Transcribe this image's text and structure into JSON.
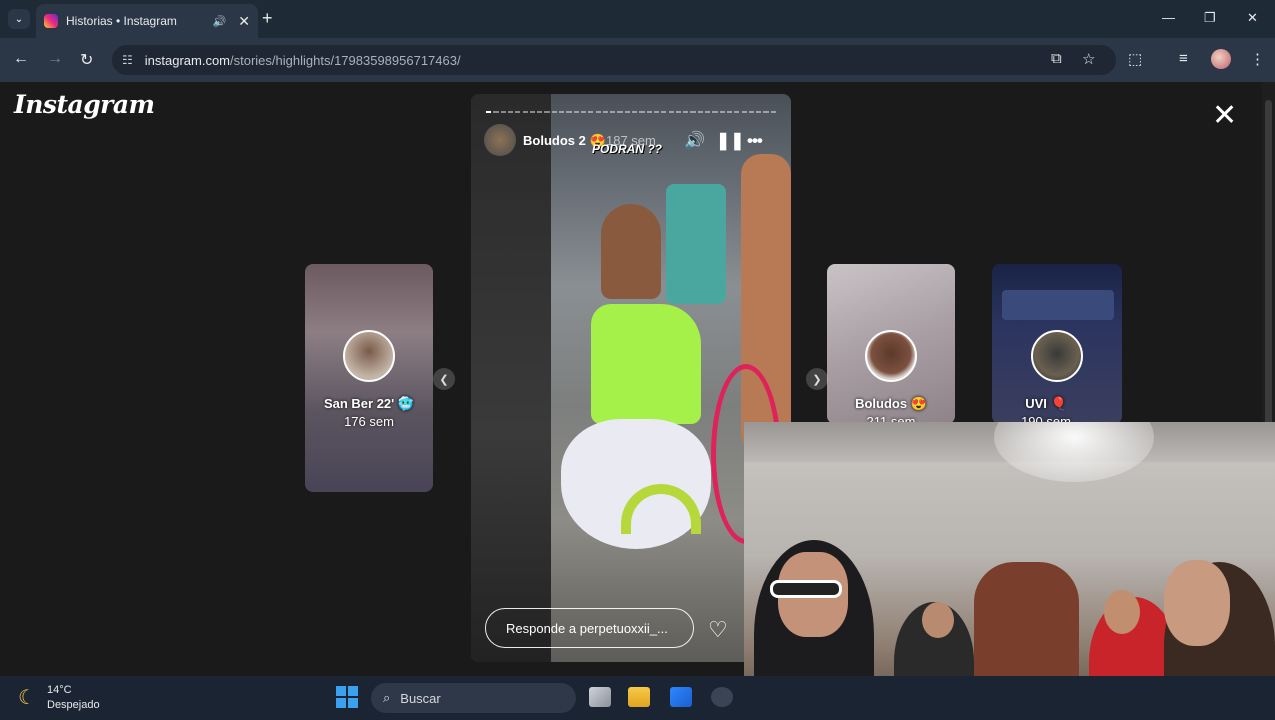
{
  "browser": {
    "tab_title": "Historias • Instagram",
    "tab_mute_icon": "speaker-icon",
    "tab_close": "✕",
    "new_tab": "+",
    "url_host": "instagram.com",
    "url_path": "/stories/highlights/17983598956717463/",
    "window_controls": {
      "minimize": "—",
      "restore": "❐",
      "close": "✕"
    }
  },
  "page": {
    "logo": "Instagram",
    "close": "✕",
    "stories_left": [
      {
        "name": "San Ber 22' 🥶",
        "time": "176 sem"
      }
    ],
    "stories_right": [
      {
        "name": "Boludos 😍",
        "time": "211 sem"
      },
      {
        "name": "UVI 🎈",
        "time": "190 sem"
      }
    ],
    "current_story": {
      "user": "Boludos 2 😍",
      "time": "187 sem",
      "overlay_text": "PODRAN ??",
      "reply_placeholder": "Responde a perpetuoxxii_...",
      "segments": 40,
      "active_segment": 0
    },
    "arrows": {
      "prev": "❮",
      "next": "❯"
    }
  },
  "taskbar": {
    "temperature": "14°C",
    "condition": "Despejado",
    "search_placeholder": "Buscar"
  }
}
